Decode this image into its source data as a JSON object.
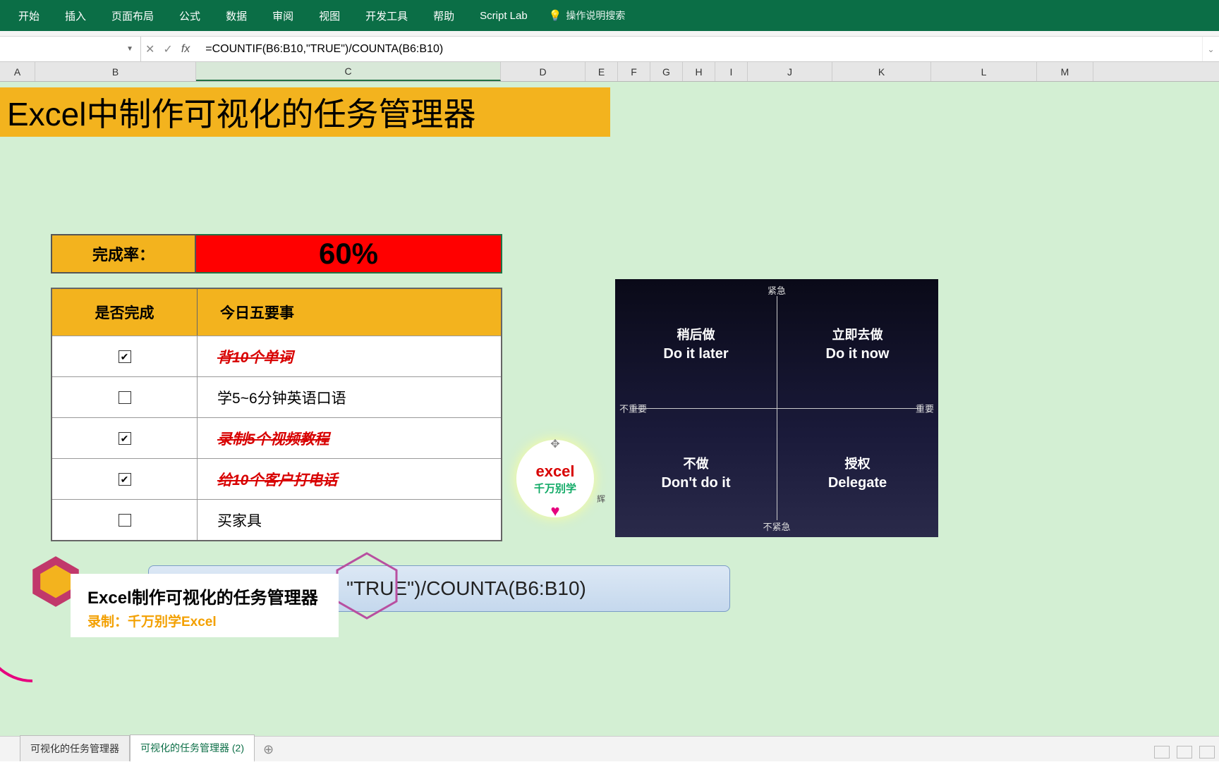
{
  "ribbon": {
    "tabs": [
      "开始",
      "插入",
      "页面布局",
      "公式",
      "数据",
      "审阅",
      "视图",
      "开发工具",
      "帮助",
      "Script Lab"
    ],
    "tell_me": "操作说明搜索"
  },
  "formula_bar": {
    "name_box": "",
    "formula": "=COUNTIF(B6:B10,\"TRUE\")/COUNTA(B6:B10)"
  },
  "columns": [
    "A",
    "B",
    "C",
    "D",
    "E",
    "F",
    "G",
    "H",
    "I",
    "J",
    "K",
    "L",
    "M"
  ],
  "selected_column": "C",
  "title": "Excel中制作可视化的任务管理器",
  "completion": {
    "label": "完成率：",
    "value": "60%"
  },
  "task_table": {
    "headers": [
      "是否完成",
      "今日五要事"
    ],
    "rows": [
      {
        "done": true,
        "task": "背10个单词"
      },
      {
        "done": false,
        "task": "学5~6分钟英语口语"
      },
      {
        "done": true,
        "task": "录制5个视频教程"
      },
      {
        "done": true,
        "task": "给10个客户打电话"
      },
      {
        "done": false,
        "task": "买家具"
      }
    ]
  },
  "quadrant": {
    "axis_top": "紧急",
    "axis_bottom": "不紧急",
    "axis_left": "不重要",
    "axis_right": "重要",
    "q1_cn": "稍后做",
    "q1_en": "Do it later",
    "q2_cn": "立即去做",
    "q2_en": "Do it now",
    "q3_cn": "不做",
    "q3_en": "Don't do it",
    "q4_cn": "授权",
    "q4_en": "Delegate"
  },
  "formula_overlay": "\"TRUE\")/COUNTA(B6:B10)",
  "caption": {
    "line1": "Excel制作可视化的任务管理器",
    "line2": "录制：千万别学Excel"
  },
  "sticker": {
    "t1": "excel",
    "t2": "千万别学",
    "side": "辉"
  },
  "sheet_tabs": {
    "tab1": "可视化的任务管理器",
    "tab2": "可视化的任务管理器 (2)"
  }
}
